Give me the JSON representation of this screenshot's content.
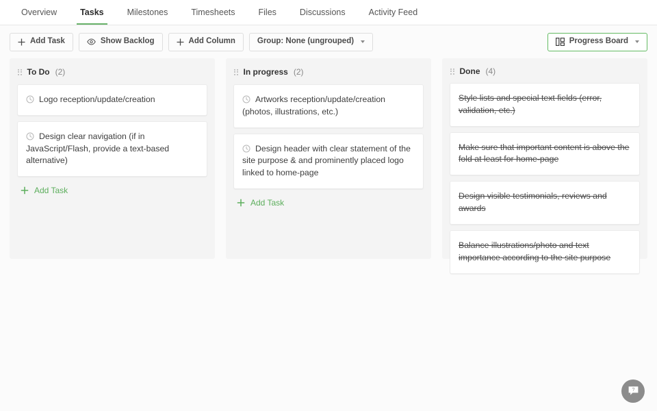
{
  "tabs": [
    {
      "label": "Overview",
      "active": false
    },
    {
      "label": "Tasks",
      "active": true
    },
    {
      "label": "Milestones",
      "active": false
    },
    {
      "label": "Timesheets",
      "active": false
    },
    {
      "label": "Files",
      "active": false
    },
    {
      "label": "Discussions",
      "active": false
    },
    {
      "label": "Activity Feed",
      "active": false
    }
  ],
  "toolbar": {
    "add_task_label": "Add Task",
    "add_task_icon": "plus-icon",
    "show_backlog_label": "Show Backlog",
    "show_backlog_icon": "eye-icon",
    "add_column_label": "Add Column",
    "add_column_icon": "plus-icon",
    "group_label": "Group: None (ungrouped)",
    "group_caret_icon": "chevron-down-icon",
    "view_label": "Progress Board",
    "view_icon": "board-icon",
    "view_caret_icon": "chevron-down-icon",
    "view_accent_color": "#63ba62"
  },
  "board": {
    "add_task_link_label": "Add Task",
    "add_task_link_icon": "plus-icon",
    "grip_icon": "drag-handle-icon",
    "card_icon": "clock-icon",
    "columns": [
      {
        "title": "To Do",
        "count": "(2)",
        "show_add_task": true,
        "cards": [
          {
            "text": "Logo reception/update/creation",
            "done": false,
            "icon": true
          },
          {
            "text": "Design clear navigation (if in JavaScript/Flash, provide a text-based alternative)",
            "done": false,
            "icon": true
          }
        ]
      },
      {
        "title": "In progress",
        "count": "(2)",
        "show_add_task": true,
        "cards": [
          {
            "text": "Artworks reception/update/creation (photos, illustrations, etc.)",
            "done": false,
            "icon": true
          },
          {
            "text": "Design header with clear statement of the site purpose & and prominently placed logo linked to home-page",
            "done": false,
            "icon": true
          }
        ]
      },
      {
        "title": "Done",
        "count": "(4)",
        "show_add_task": false,
        "cards": [
          {
            "text": "Style lists and special text fields (error, validation, etc.)",
            "done": true,
            "icon": false
          },
          {
            "text": "Make sure that important content is above the fold at least for home-page",
            "done": true,
            "icon": false
          },
          {
            "text": "Design visible testimonials, reviews and awards",
            "done": true,
            "icon": false
          },
          {
            "text": "Balance illustrations/photo and text importance according to the site purpose",
            "done": true,
            "icon": false
          }
        ]
      }
    ]
  },
  "help": {
    "icon": "help-chat-icon",
    "tooltip": "?"
  }
}
